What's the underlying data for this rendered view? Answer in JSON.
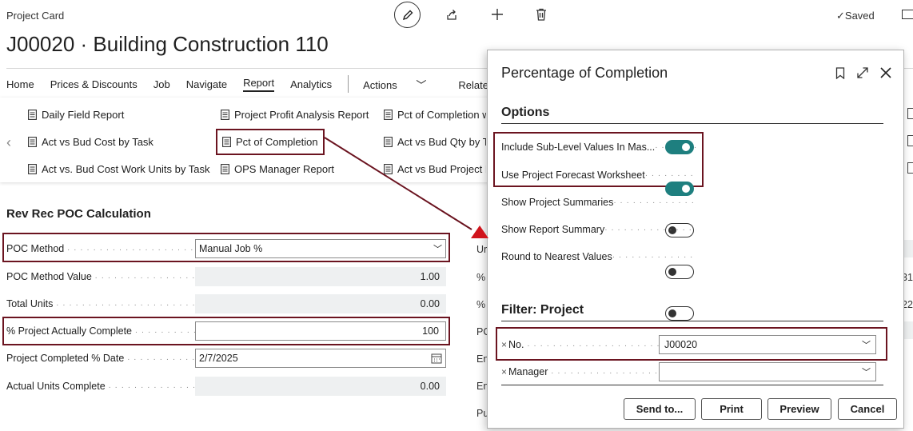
{
  "header": {
    "card_label": "Project Card",
    "title": "J00020 · Building Construction 110",
    "saved_label": "Saved"
  },
  "nav": {
    "items": [
      "Home",
      "Prices & Discounts",
      "Job",
      "Navigate",
      "Report",
      "Analytics"
    ],
    "actions": "Actions",
    "related": "Related"
  },
  "reports": {
    "col1": [
      "Daily Field Report",
      "Act vs Bud Cost by Task",
      "Act vs. Bud Cost Work Units by Task"
    ],
    "col2": [
      "Project Profit Analysis Report",
      "Pct of Completion",
      "OPS Manager Report"
    ],
    "col3": [
      "Pct of Completion w",
      "Act vs Bud Qty by Ta",
      "Act vs Bud Project H"
    ]
  },
  "section": {
    "title": "Rev Rec POC Calculation",
    "fields": [
      {
        "label": "POC Method",
        "value": "Manual Job %"
      },
      {
        "label": "POC Method Value",
        "value": "1.00"
      },
      {
        "label": "Total Units",
        "value": "0.00"
      },
      {
        "label": "% Project Actually Complete",
        "value": "100"
      },
      {
        "label": "Project Completed % Date",
        "value": "2/7/2025"
      },
      {
        "label": "Actual Units Complete",
        "value": "0.00"
      }
    ],
    "peek_labels": [
      "Ur",
      "%",
      "%",
      "PO",
      "En",
      "En",
      "Pu"
    ],
    "peek_right": [
      "31",
      "22"
    ]
  },
  "dialog": {
    "title": "Percentage of Completion",
    "options_title": "Options",
    "options": [
      {
        "label": "Include Sub-Level Values In Mas...",
        "on": true
      },
      {
        "label": "Use Project Forecast Worksheet",
        "on": true
      },
      {
        "label": "Show Project Summaries",
        "on": false
      },
      {
        "label": "Show Report Summary",
        "on": false
      },
      {
        "label": "Round to Nearest Values",
        "on": false
      }
    ],
    "filter_title": "Filter: Project",
    "filters": [
      {
        "label": "No.",
        "value": "J00020"
      },
      {
        "label": "Manager",
        "value": ""
      }
    ],
    "buttons": {
      "send_to": "Send to...",
      "print": "Print",
      "preview": "Preview",
      "cancel": "Cancel"
    }
  },
  "colors": {
    "highlight": "#6b1420",
    "toggle_on": "#1e7f7f",
    "arrow": "#d0141c"
  }
}
